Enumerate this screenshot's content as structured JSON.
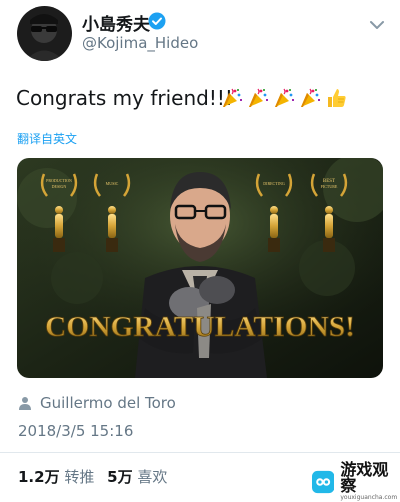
{
  "user": {
    "display_name": "小島秀夫",
    "handle": "@Kojima_Hideo"
  },
  "tweet": {
    "text": "Congrats my friend!!!",
    "translate_label": "翻译自英文",
    "emoji_names": [
      "party-popper-icon",
      "party-popper-icon",
      "party-popper-icon",
      "party-popper-icon",
      "thumbs-up-icon"
    ]
  },
  "media": {
    "awards": [
      {
        "line1": "PRODUCTION",
        "line2": "DESIGN"
      },
      {
        "line1": "MUSIC",
        "line2": ""
      },
      {
        "line1": "DIRECTING",
        "line2": ""
      },
      {
        "line1": "BEST",
        "line2": "PICTURE"
      }
    ],
    "banner_text": "CONGRATULATIONS!"
  },
  "author": {
    "name": "Guillermo del Toro"
  },
  "timestamp": "2018/3/5 15:16",
  "stats": {
    "retweets_count": "1.2万",
    "retweets_label": "转推",
    "likes_count": "5万",
    "likes_label": "喜欢"
  },
  "watermark": {
    "name": "游戏观察",
    "url": "youxiguancha.com"
  },
  "colors": {
    "link_blue": "#1da1f2",
    "secondary_text": "#657786",
    "gold": "#d4a437"
  }
}
